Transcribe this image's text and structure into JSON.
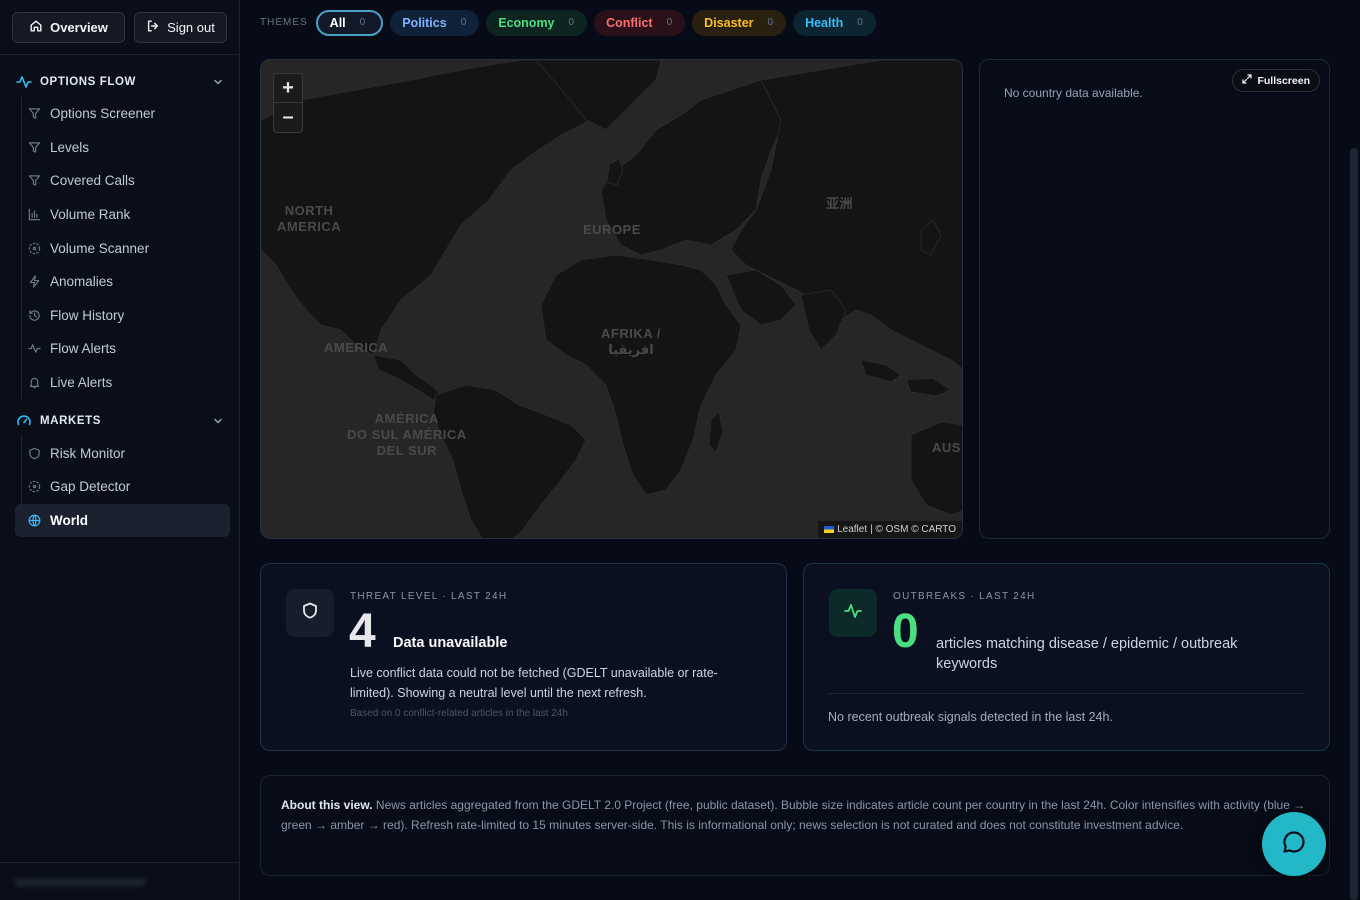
{
  "sidebar": {
    "overview_label": "Overview",
    "signout_label": "Sign out",
    "sections": [
      {
        "title": "OPTIONS FLOW",
        "items": [
          {
            "label": "Options Screener",
            "icon": "filter-icon"
          },
          {
            "label": "Levels",
            "icon": "filter-icon"
          },
          {
            "label": "Covered Calls",
            "icon": "filter-icon"
          },
          {
            "label": "Volume Rank",
            "icon": "bar-chart-icon"
          },
          {
            "label": "Volume Scanner",
            "icon": "scanner-icon"
          },
          {
            "label": "Anomalies",
            "icon": "lightning-icon"
          },
          {
            "label": "Flow History",
            "icon": "history-icon"
          },
          {
            "label": "Flow Alerts",
            "icon": "activity-icon"
          },
          {
            "label": "Live Alerts",
            "icon": "bell-icon"
          }
        ]
      },
      {
        "title": "MARKETS",
        "items": [
          {
            "label": "Risk Monitor",
            "icon": "shield-icon"
          },
          {
            "label": "Gap Detector",
            "icon": "scanner-icon"
          },
          {
            "label": "World",
            "icon": "globe-icon",
            "active": true
          }
        ]
      }
    ],
    "footer_blurred": "■■■■■■■■■■■■■■■■■■"
  },
  "themes": {
    "label": "THEMES",
    "chips": [
      {
        "label": "All",
        "count": "0",
        "active": true
      },
      {
        "label": "Politics",
        "count": "0"
      },
      {
        "label": "Economy",
        "count": "0"
      },
      {
        "label": "Conflict",
        "count": "0"
      },
      {
        "label": "Disaster",
        "count": "0"
      },
      {
        "label": "Health",
        "count": "0"
      }
    ]
  },
  "map": {
    "zoom_in": "+",
    "zoom_out": "–",
    "labels": {
      "north_america": "NORTH\nAMERICA",
      "europe": "EUROPE",
      "asia": "亚洲",
      "africa": "AFRIKA /\nافريقيا",
      "america": "AMERICA",
      "south_america": "AMÉRICA\nDO SUL AMÉRICA\nDEL SUR",
      "australia": "AUS"
    },
    "attribution_leaflet": "Leaflet",
    "attribution_rest": "| © OSM © CARTO"
  },
  "country_panel": {
    "message": "No country data available.",
    "fullscreen_label": "Fullscreen"
  },
  "threat": {
    "kicker": "THREAT LEVEL · LAST 24H",
    "value": "4",
    "status": "Data unavailable",
    "description": "Live conflict data could not be fetched (GDELT unavailable or rate-limited). Showing a neutral level until the next refresh.",
    "footnote": "Based on 0 conflict-related articles in the last 24h"
  },
  "outbreaks": {
    "kicker": "OUTBREAKS · LAST 24H",
    "value": "0",
    "status": "articles matching disease / epidemic / outbreak keywords",
    "footnote": "No recent outbreak signals detected in the last 24h."
  },
  "about": {
    "heading": "About this view.",
    "text": "News articles aggregated from the GDELT 2.0 Project (free, public dataset). Bubble size indicates article count per country in the last 24h. Color intensifies with activity (blue → green → amber → red). Refresh rate-limited to 15 minutes server-side. This is informational only; news selection is not curated and does not constitute investment advice."
  },
  "colors": {
    "accent": "#22b8c8",
    "background": "#070b17",
    "map": "#262626",
    "outbreak_value": "#4ade80"
  }
}
